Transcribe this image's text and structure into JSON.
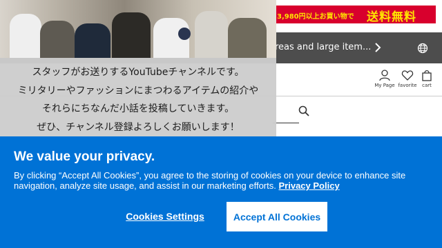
{
  "promo_banner": {
    "price_text": "3,980円以上お買い物で",
    "shipping_text": "送料無料",
    "colors": {
      "background": "#d8002d",
      "text": "#ffe400"
    }
  },
  "notice_bar": {
    "text": "reas and large item...",
    "chevron_icon": "chevron-right-icon",
    "globe_icon": "globe-icon"
  },
  "header": {
    "my_page_label": "My Page",
    "favorite_label": "favorite",
    "cart_label": "cart"
  },
  "search": {
    "icon": "search-icon"
  },
  "youtube_promo": {
    "lines": [
      "スタッフがお送りするYouTubeチャンネルです。",
      "ミリタリーやファッションにまつわるアイテムの紹介や",
      "それらにちなんだ小話を投稿していきます。",
      "ぜひ、チャンネル登録よろしくお願いします！"
    ]
  },
  "cookie_banner": {
    "title": "We value your privacy.",
    "description": "By clicking “Accept All Cookies”, you agree to the storing of cookies on your device to enhance site navigation, analyze site usage, and assist in our marketing efforts.",
    "policy_link": "Privacy Policy",
    "settings_label": "Cookies Settings",
    "accept_label": "Accept All Cookies",
    "colors": {
      "background": "#0072d6",
      "button_bg": "#ffffff",
      "button_text": "#0072d6"
    }
  }
}
